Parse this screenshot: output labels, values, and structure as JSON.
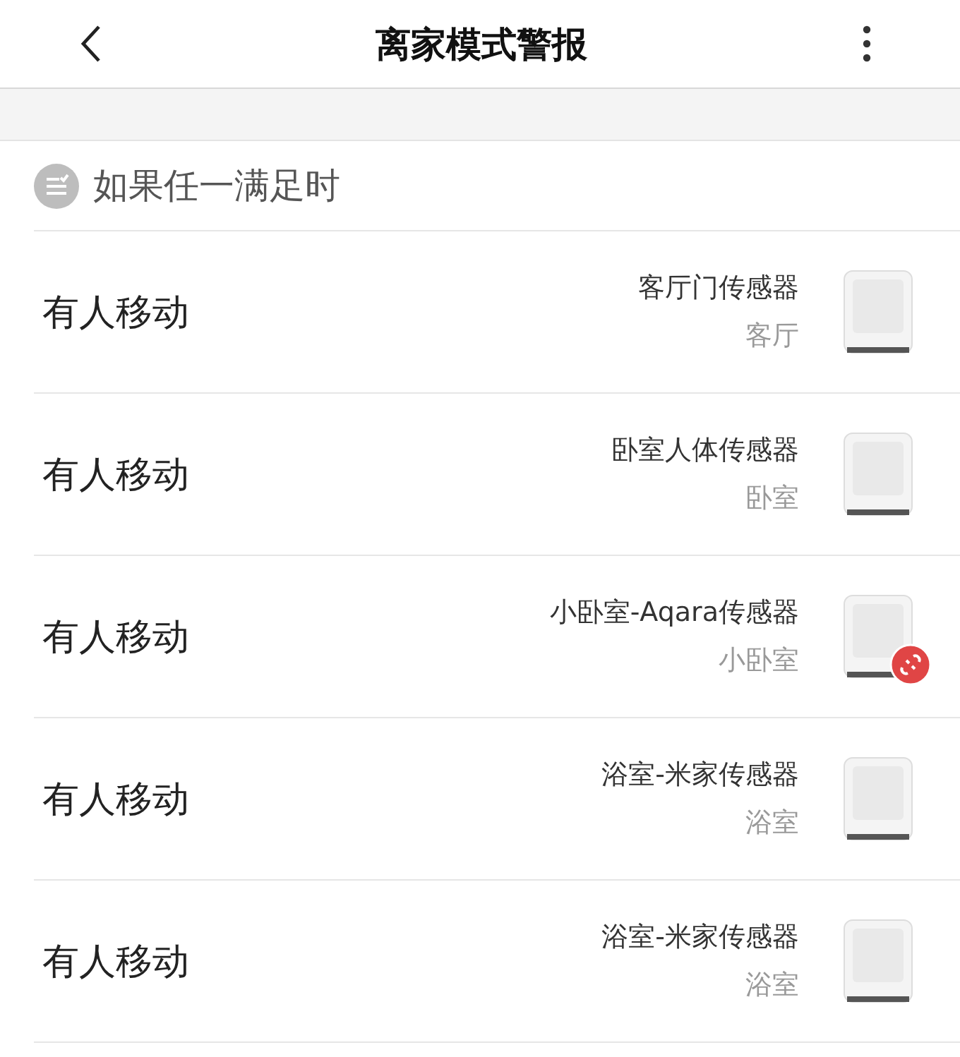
{
  "header": {
    "title": "离家模式警报"
  },
  "condition": {
    "label": "如果任一满足时"
  },
  "rows": [
    {
      "trigger": "有人移动",
      "device": "客厅门传感器",
      "room": "客厅",
      "disconnected": false
    },
    {
      "trigger": "有人移动",
      "device": "卧室人体传感器",
      "room": "卧室",
      "disconnected": false
    },
    {
      "trigger": "有人移动",
      "device": "小卧室-Aqara传感器",
      "room": "小卧室",
      "disconnected": true
    },
    {
      "trigger": "有人移动",
      "device": "浴室-米家传感器",
      "room": "浴室",
      "disconnected": false
    },
    {
      "trigger": "有人移动",
      "device": "浴室-米家传感器",
      "room": "浴室",
      "disconnected": false
    }
  ]
}
